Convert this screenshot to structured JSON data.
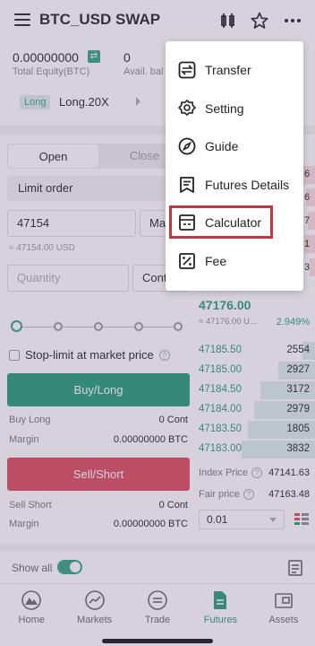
{
  "header": {
    "title": "BTC_USD SWAP"
  },
  "equity": {
    "total_value": "0.00000000",
    "total_label": "Total Equity(BTC)",
    "avail_value": "0",
    "avail_label": "Avail. bal"
  },
  "leverage": {
    "tag": "Long",
    "value": "Long.20X"
  },
  "order_form": {
    "tab_open": "Open",
    "tab_close": "Close",
    "order_type": "Limit order",
    "price_value": "47154",
    "price_unit_fragment": "Ma",
    "usd_hint": "≈ 47154.00 USD",
    "quantity_placeholder": "Quantity",
    "quantity_unit_fragment": "Cont",
    "stop_limit_label": "Stop-limit at market price",
    "buy_label": "Buy/Long",
    "sell_label": "Sell/Short",
    "buy_long_label": "Buy Long",
    "buy_long_value": "0 Cont",
    "buy_margin_label": "Margin",
    "buy_margin_value": "0.00000000 BTC",
    "sell_short_label": "Sell Short",
    "sell_short_value": "0 Cont",
    "sell_margin_label": "Margin",
    "sell_margin_value": "0.00000000 BTC"
  },
  "orderbook": {
    "mark_price": "47176.00",
    "mark_usd": "≈ 47176.00 U...",
    "change_pct": "2.949%",
    "bids": [
      {
        "price": "47185.50",
        "qty": "2554",
        "fill": 0.1
      },
      {
        "price": "47185.00",
        "qty": "2927",
        "fill": 0.3
      },
      {
        "price": "47184.50",
        "qty": "3172",
        "fill": 0.45
      },
      {
        "price": "47184.00",
        "qty": "2979",
        "fill": 0.5
      },
      {
        "price": "47183.50",
        "qty": "1805",
        "fill": 0.55
      },
      {
        "price": "47183.00",
        "qty": "3832",
        "fill": 0.6
      }
    ],
    "right_edge_fragments": [
      "6",
      "6",
      "7",
      "1",
      "3"
    ],
    "index_price_label": "Index Price",
    "index_price_value": "47141.63",
    "fair_price_label": "Fair price",
    "fair_price_value": "47163.48",
    "depth_value": "0.01"
  },
  "showall": {
    "label": "Show all"
  },
  "bottom_nav": [
    {
      "label": "Home"
    },
    {
      "label": "Markets"
    },
    {
      "label": "Trade"
    },
    {
      "label": "Futures"
    },
    {
      "label": "Assets"
    }
  ],
  "menu": {
    "items": [
      {
        "label": "Transfer"
      },
      {
        "label": "Setting"
      },
      {
        "label": "Guide"
      },
      {
        "label": "Futures Details"
      },
      {
        "label": "Calculator"
      },
      {
        "label": "Fee"
      }
    ]
  },
  "colors": {
    "accent_green": "#1f9d73",
    "sell_red": "#d84a5b",
    "highlight_red": "#c8343d"
  }
}
